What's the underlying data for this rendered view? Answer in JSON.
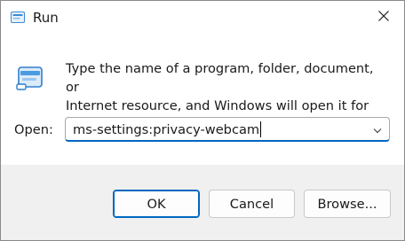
{
  "window": {
    "title": "Run"
  },
  "icons": {
    "title": "run-app-icon",
    "close": "close-icon",
    "main": "run-app-icon",
    "dropdown": "chevron-down-icon"
  },
  "colors": {
    "accent": "#0067c0",
    "footer_bg": "#f0f0f0",
    "icon_blue": "#4a9be0"
  },
  "description": {
    "line1": "Type the name of a program, folder, document, or",
    "line2": "Internet resource, and Windows will open it for you."
  },
  "open": {
    "label": "Open:",
    "value": "ms-settings:privacy-webcam"
  },
  "buttons": {
    "ok": "OK",
    "cancel": "Cancel",
    "browse": "Browse..."
  }
}
